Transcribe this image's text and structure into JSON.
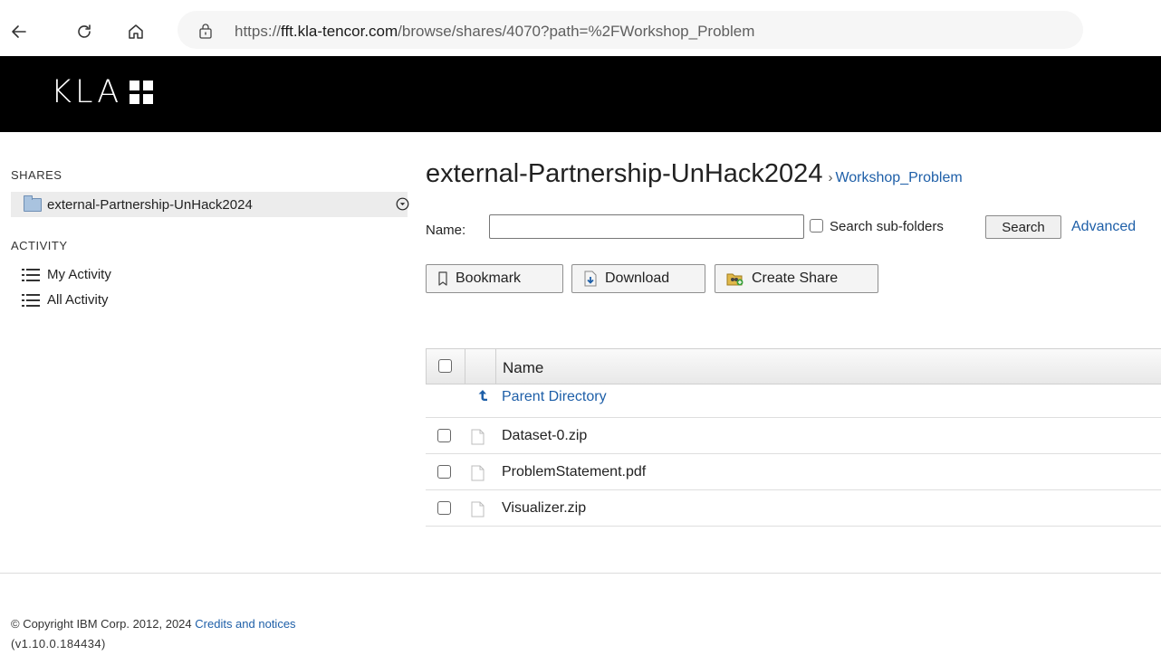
{
  "browser": {
    "url_prefix": "https://",
    "url_host": "fft.kla-tencor.com",
    "url_path": "/browse/shares/4070?path=%2FWorkshop_Problem"
  },
  "header": {
    "logo_text": "KLA"
  },
  "sidebar": {
    "shares_heading": "SHARES",
    "share_item": "external-Partnership-UnHack2024",
    "activity_heading": "ACTIVITY",
    "activity_items": [
      "My Activity",
      "All Activity"
    ]
  },
  "main": {
    "title": "external-Partnership-UnHack2024",
    "breadcrumb_sep": "›",
    "breadcrumb_current": "Workshop_Problem",
    "search": {
      "name_label": "Name:",
      "name_value": "",
      "subfolders_label": "Search sub-folders",
      "search_button": "Search",
      "advanced_link": "Advanced"
    },
    "toolbar": {
      "bookmark": "Bookmark",
      "download": "Download",
      "create_share": "Create Share"
    },
    "table": {
      "column_name": "Name",
      "parent_directory": "Parent Directory",
      "files": [
        "Dataset-0.zip",
        "ProblemStatement.pdf",
        "Visualizer.zip"
      ]
    }
  },
  "footer": {
    "copyright": "© Copyright IBM Corp. 2012, 2024",
    "credits": "Credits and notices",
    "version": "(v1.10.0.184434)"
  },
  "colors": {
    "link": "#1e5fa8",
    "header_bg": "#000000",
    "selected_bg": "#ececec"
  }
}
